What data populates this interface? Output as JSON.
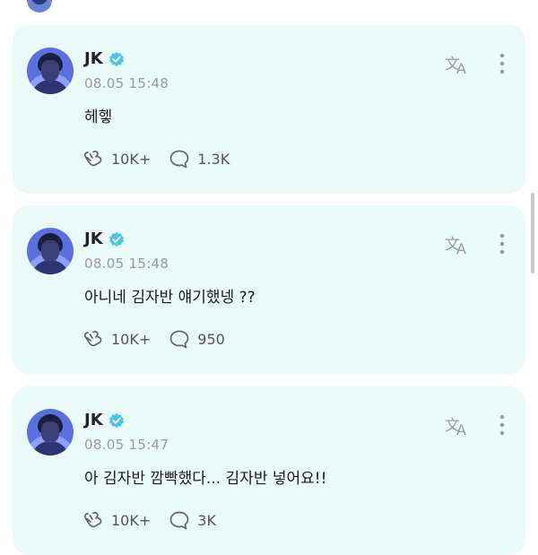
{
  "colors": {
    "card_bg": "#eafaf8",
    "accent": "#2ec7c0",
    "verified": "#4ec5e8"
  },
  "posts": [
    {
      "author": "JK",
      "time": "08.05 15:48",
      "text": "헤헿",
      "likes": "10K+",
      "comments": "1.3K"
    },
    {
      "author": "JK",
      "time": "08.05 15:48",
      "text": "아니네 김자반 얘기했넹 ??",
      "likes": "10K+",
      "comments": "950"
    },
    {
      "author": "JK",
      "time": "08.05 15:47",
      "text": "아 김자반 깜빡했다... 김자반 넣어요!!",
      "likes": "10K+",
      "comments": "3K"
    }
  ],
  "icons": {
    "verified": "verified-badge-icon",
    "translate": "translate-icon",
    "more": "more-vertical-icon",
    "likes": "heart-hands-icon",
    "comments": "comment-bubble-icon"
  }
}
